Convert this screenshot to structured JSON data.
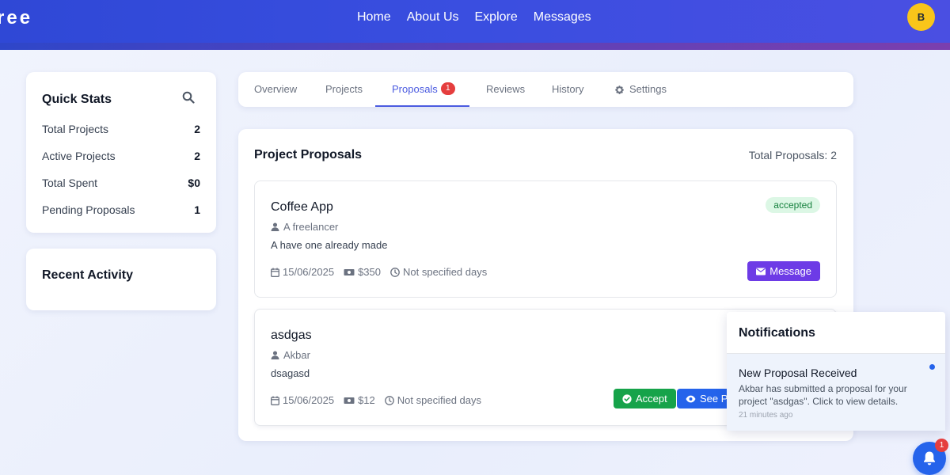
{
  "header": {
    "logo": "ree",
    "nav": [
      "Home",
      "About Us",
      "Explore",
      "Messages"
    ],
    "avatar_initial": "B"
  },
  "stats": {
    "title": "Quick Stats",
    "rows": [
      {
        "label": "Total Projects",
        "value": "2"
      },
      {
        "label": "Active Projects",
        "value": "2"
      },
      {
        "label": "Total Spent",
        "value": "$0"
      },
      {
        "label": "Pending Proposals",
        "value": "1"
      }
    ]
  },
  "activity": {
    "title": "Recent Activity"
  },
  "tabs": [
    {
      "label": "Overview"
    },
    {
      "label": "Projects"
    },
    {
      "label": "Proposals",
      "badge": "1",
      "active": true
    },
    {
      "label": "Reviews"
    },
    {
      "label": "History"
    },
    {
      "label": "Settings",
      "icon": "gear-icon"
    }
  ],
  "proposals": {
    "title": "Project Proposals",
    "total": "Total Proposals: 2",
    "items": [
      {
        "title": "Coffee App",
        "author": "A freelancer",
        "description": "A have one already made",
        "date": "15/06/2025",
        "amount": "$350",
        "duration": "Not specified days",
        "status": "accepted",
        "message_label": "Message"
      },
      {
        "title": "asdgas",
        "author": "Akbar",
        "description": "dsagasd",
        "date": "15/06/2025",
        "amount": "$12",
        "duration": "Not specified days",
        "accept_label": "Accept",
        "see_label": "See Pro"
      }
    ]
  },
  "notifications": {
    "title": "Notifications",
    "items": [
      {
        "title": "New Proposal Received",
        "body": "Akbar has submitted a proposal for your project \"asdgas\". Click to view details.",
        "time": "21 minutes ago"
      }
    ],
    "badge_count": "1"
  },
  "colors": {
    "primary": "#2f48d6",
    "accent": "#4b5be0",
    "success": "#16a34a",
    "message": "#6d3be6",
    "info": "#2563eb",
    "danger": "#e53e3e",
    "avatar": "#f9c51a"
  }
}
